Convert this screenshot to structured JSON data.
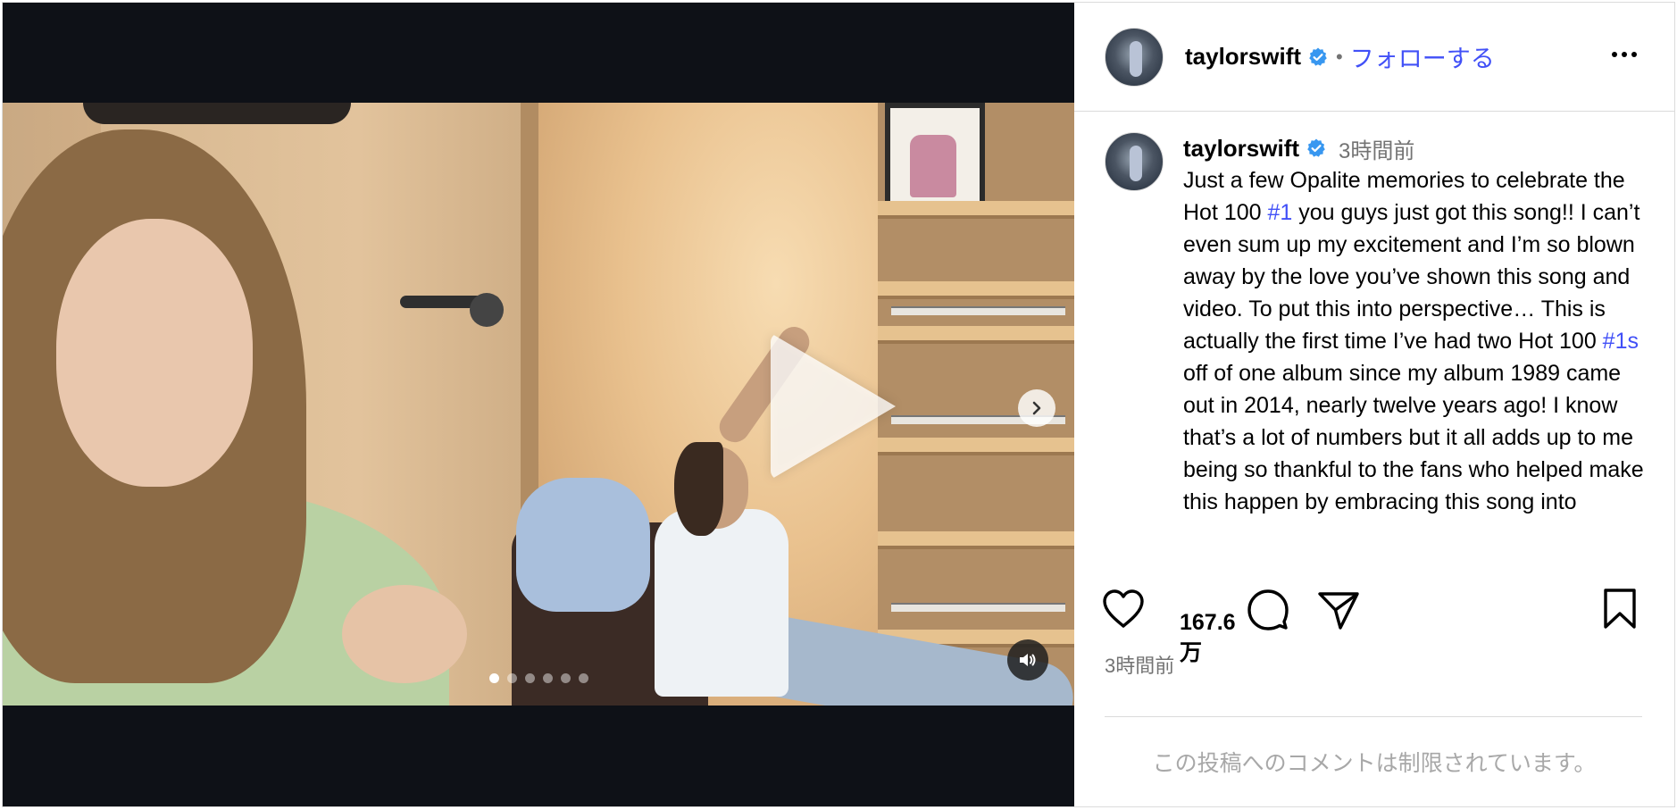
{
  "post": {
    "author": {
      "username": "taylorswift",
      "separator": "•",
      "follow_label": "フォローする"
    },
    "caption": {
      "username": "taylorswift",
      "time": "3時間前",
      "text_part1": "Just a few Opalite memories to celebrate the Hot 100 ",
      "hashtag1": "#1",
      "text_part2": " you guys just got this song!! I can’t even sum up my excitement and I’m so blown away by the love you’ve shown this song and video. To put this into perspective… This is actually the first time I’ve had two Hot 100 ",
      "hashtag2": "#1s",
      "text_part3": " off of one album since my album 1989 came out in 2014, nearly twelve years ago! I know that’s a lot of numbers but it all adds up to me being so thankful to the fans who helped make this happen by embracing this song into"
    },
    "likes": "167.6\n万",
    "likes_line1": "167.6",
    "likes_line2": "万",
    "post_time": "3時間前",
    "comments_limited": "この投稿へのコメントは制限されています。"
  },
  "media": {
    "carousel_count": 6,
    "active_index": 0,
    "type": "video"
  },
  "icons": {
    "verified": "verified-badge-icon",
    "more": "more-options-icon",
    "like": "heart-icon",
    "comment": "comment-icon",
    "share": "share-icon",
    "save": "bookmark-icon",
    "play": "play-icon",
    "next": "chevron-right-icon",
    "sound": "speaker-icon"
  },
  "colors": {
    "link": "#4150f7",
    "verified": "#3897f0",
    "muted": "#737373",
    "border": "#dbdbdb"
  }
}
